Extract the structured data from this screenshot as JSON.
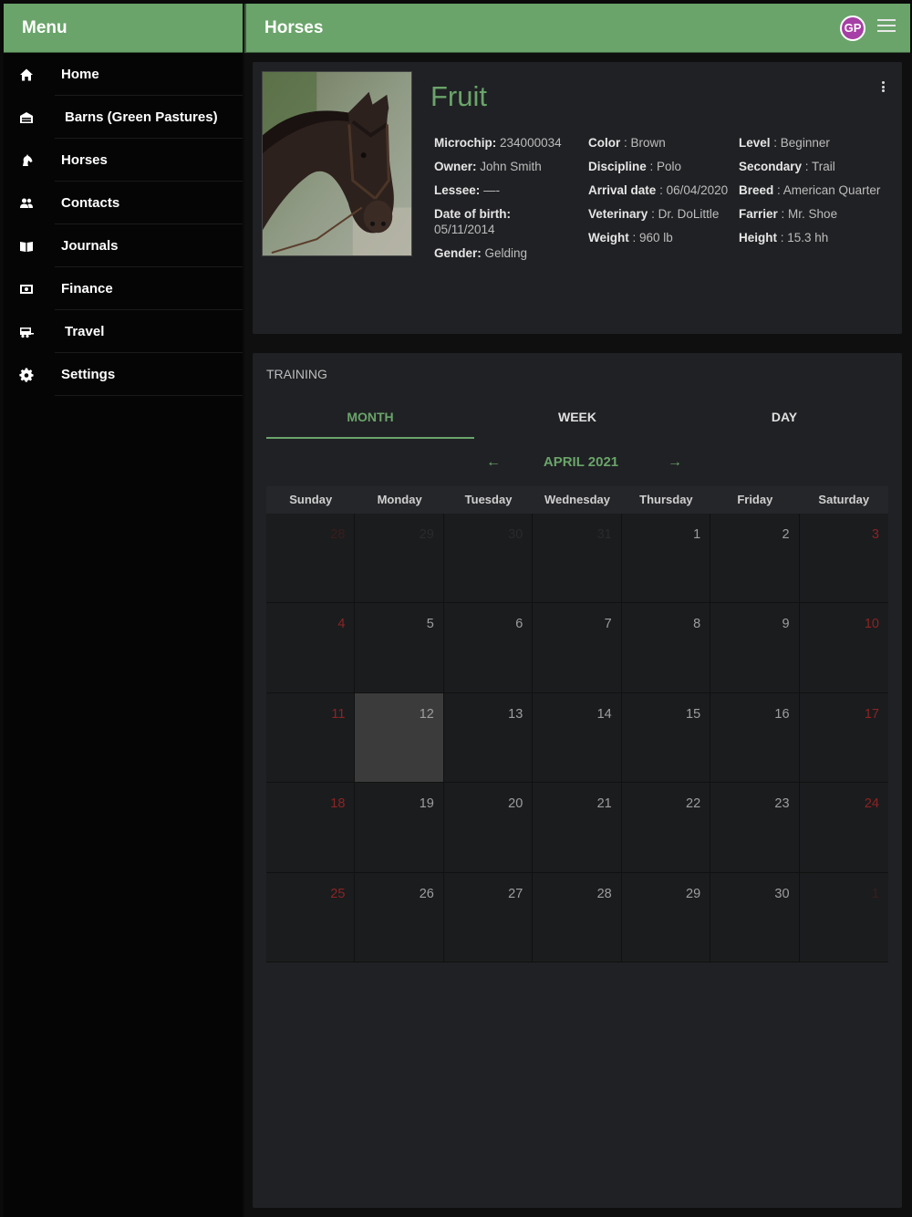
{
  "sidebar": {
    "header": "Menu",
    "items": [
      {
        "label": "Home",
        "icon": "home-icon"
      },
      {
        "label": "Barns (Green Pastures)",
        "icon": "barn-icon"
      },
      {
        "label": "Horses",
        "icon": "horse-icon"
      },
      {
        "label": "Contacts",
        "icon": "contacts-icon"
      },
      {
        "label": "Journals",
        "icon": "book-icon"
      },
      {
        "label": "Finance",
        "icon": "finance-icon"
      },
      {
        "label": "Travel",
        "icon": "trailer-icon"
      },
      {
        "label": "Settings",
        "icon": "gear-icon"
      }
    ]
  },
  "topbar": {
    "title": "Horses",
    "avatar_initials": "GP",
    "avatar_color": "#a63fa6",
    "accent_color": "#6aa46a"
  },
  "horse": {
    "name": "Fruit",
    "col1": [
      {
        "label": "Microchip:",
        "value": "234000034"
      },
      {
        "label": "Owner:",
        "value": "John Smith"
      },
      {
        "label": "Lessee:",
        "value": "—-"
      },
      {
        "label": "Date of birth:",
        "value": "05/11/2014"
      },
      {
        "label": "Gender:",
        "value": "Gelding"
      }
    ],
    "col2": [
      {
        "label": "Color",
        "value": ": Brown"
      },
      {
        "label": "Discipline",
        "value": ": Polo"
      },
      {
        "label": "Arrival date",
        "value": ": 06/04/2020"
      },
      {
        "label": "Veterinary",
        "value": ": Dr. DoLittle"
      },
      {
        "label": "Weight",
        "value": ": 960 lb"
      }
    ],
    "col3": [
      {
        "label": "Level",
        "value": ": Beginner"
      },
      {
        "label": "Secondary",
        "value": ": Trail"
      },
      {
        "label": "Breed",
        "value": ": American Quarter"
      },
      {
        "label": "Farrier",
        "value": ": Mr. Shoe"
      },
      {
        "label": "Height",
        "value": ": 15.3 hh"
      }
    ]
  },
  "training": {
    "label": "TRAINING",
    "tabs": [
      "MONTH",
      "WEEK",
      "DAY"
    ],
    "active_tab": "MONTH",
    "month_label": "APRIL 2021",
    "weekdays": [
      "Sunday",
      "Monday",
      "Tuesday",
      "Wednesday",
      "Thursday",
      "Friday",
      "Saturday"
    ],
    "days": [
      {
        "n": "28",
        "out": true
      },
      {
        "n": "29",
        "out": true
      },
      {
        "n": "30",
        "out": true
      },
      {
        "n": "31",
        "out": true
      },
      {
        "n": "1"
      },
      {
        "n": "2"
      },
      {
        "n": "3"
      },
      {
        "n": "4"
      },
      {
        "n": "5"
      },
      {
        "n": "6"
      },
      {
        "n": "7"
      },
      {
        "n": "8"
      },
      {
        "n": "9"
      },
      {
        "n": "10"
      },
      {
        "n": "11"
      },
      {
        "n": "12",
        "today": true
      },
      {
        "n": "13"
      },
      {
        "n": "14"
      },
      {
        "n": "15"
      },
      {
        "n": "16"
      },
      {
        "n": "17"
      },
      {
        "n": "18"
      },
      {
        "n": "19"
      },
      {
        "n": "20"
      },
      {
        "n": "21"
      },
      {
        "n": "22"
      },
      {
        "n": "23"
      },
      {
        "n": "24"
      },
      {
        "n": "25"
      },
      {
        "n": "26"
      },
      {
        "n": "27"
      },
      {
        "n": "28"
      },
      {
        "n": "29"
      },
      {
        "n": "30"
      },
      {
        "n": "1",
        "out": true
      }
    ]
  }
}
